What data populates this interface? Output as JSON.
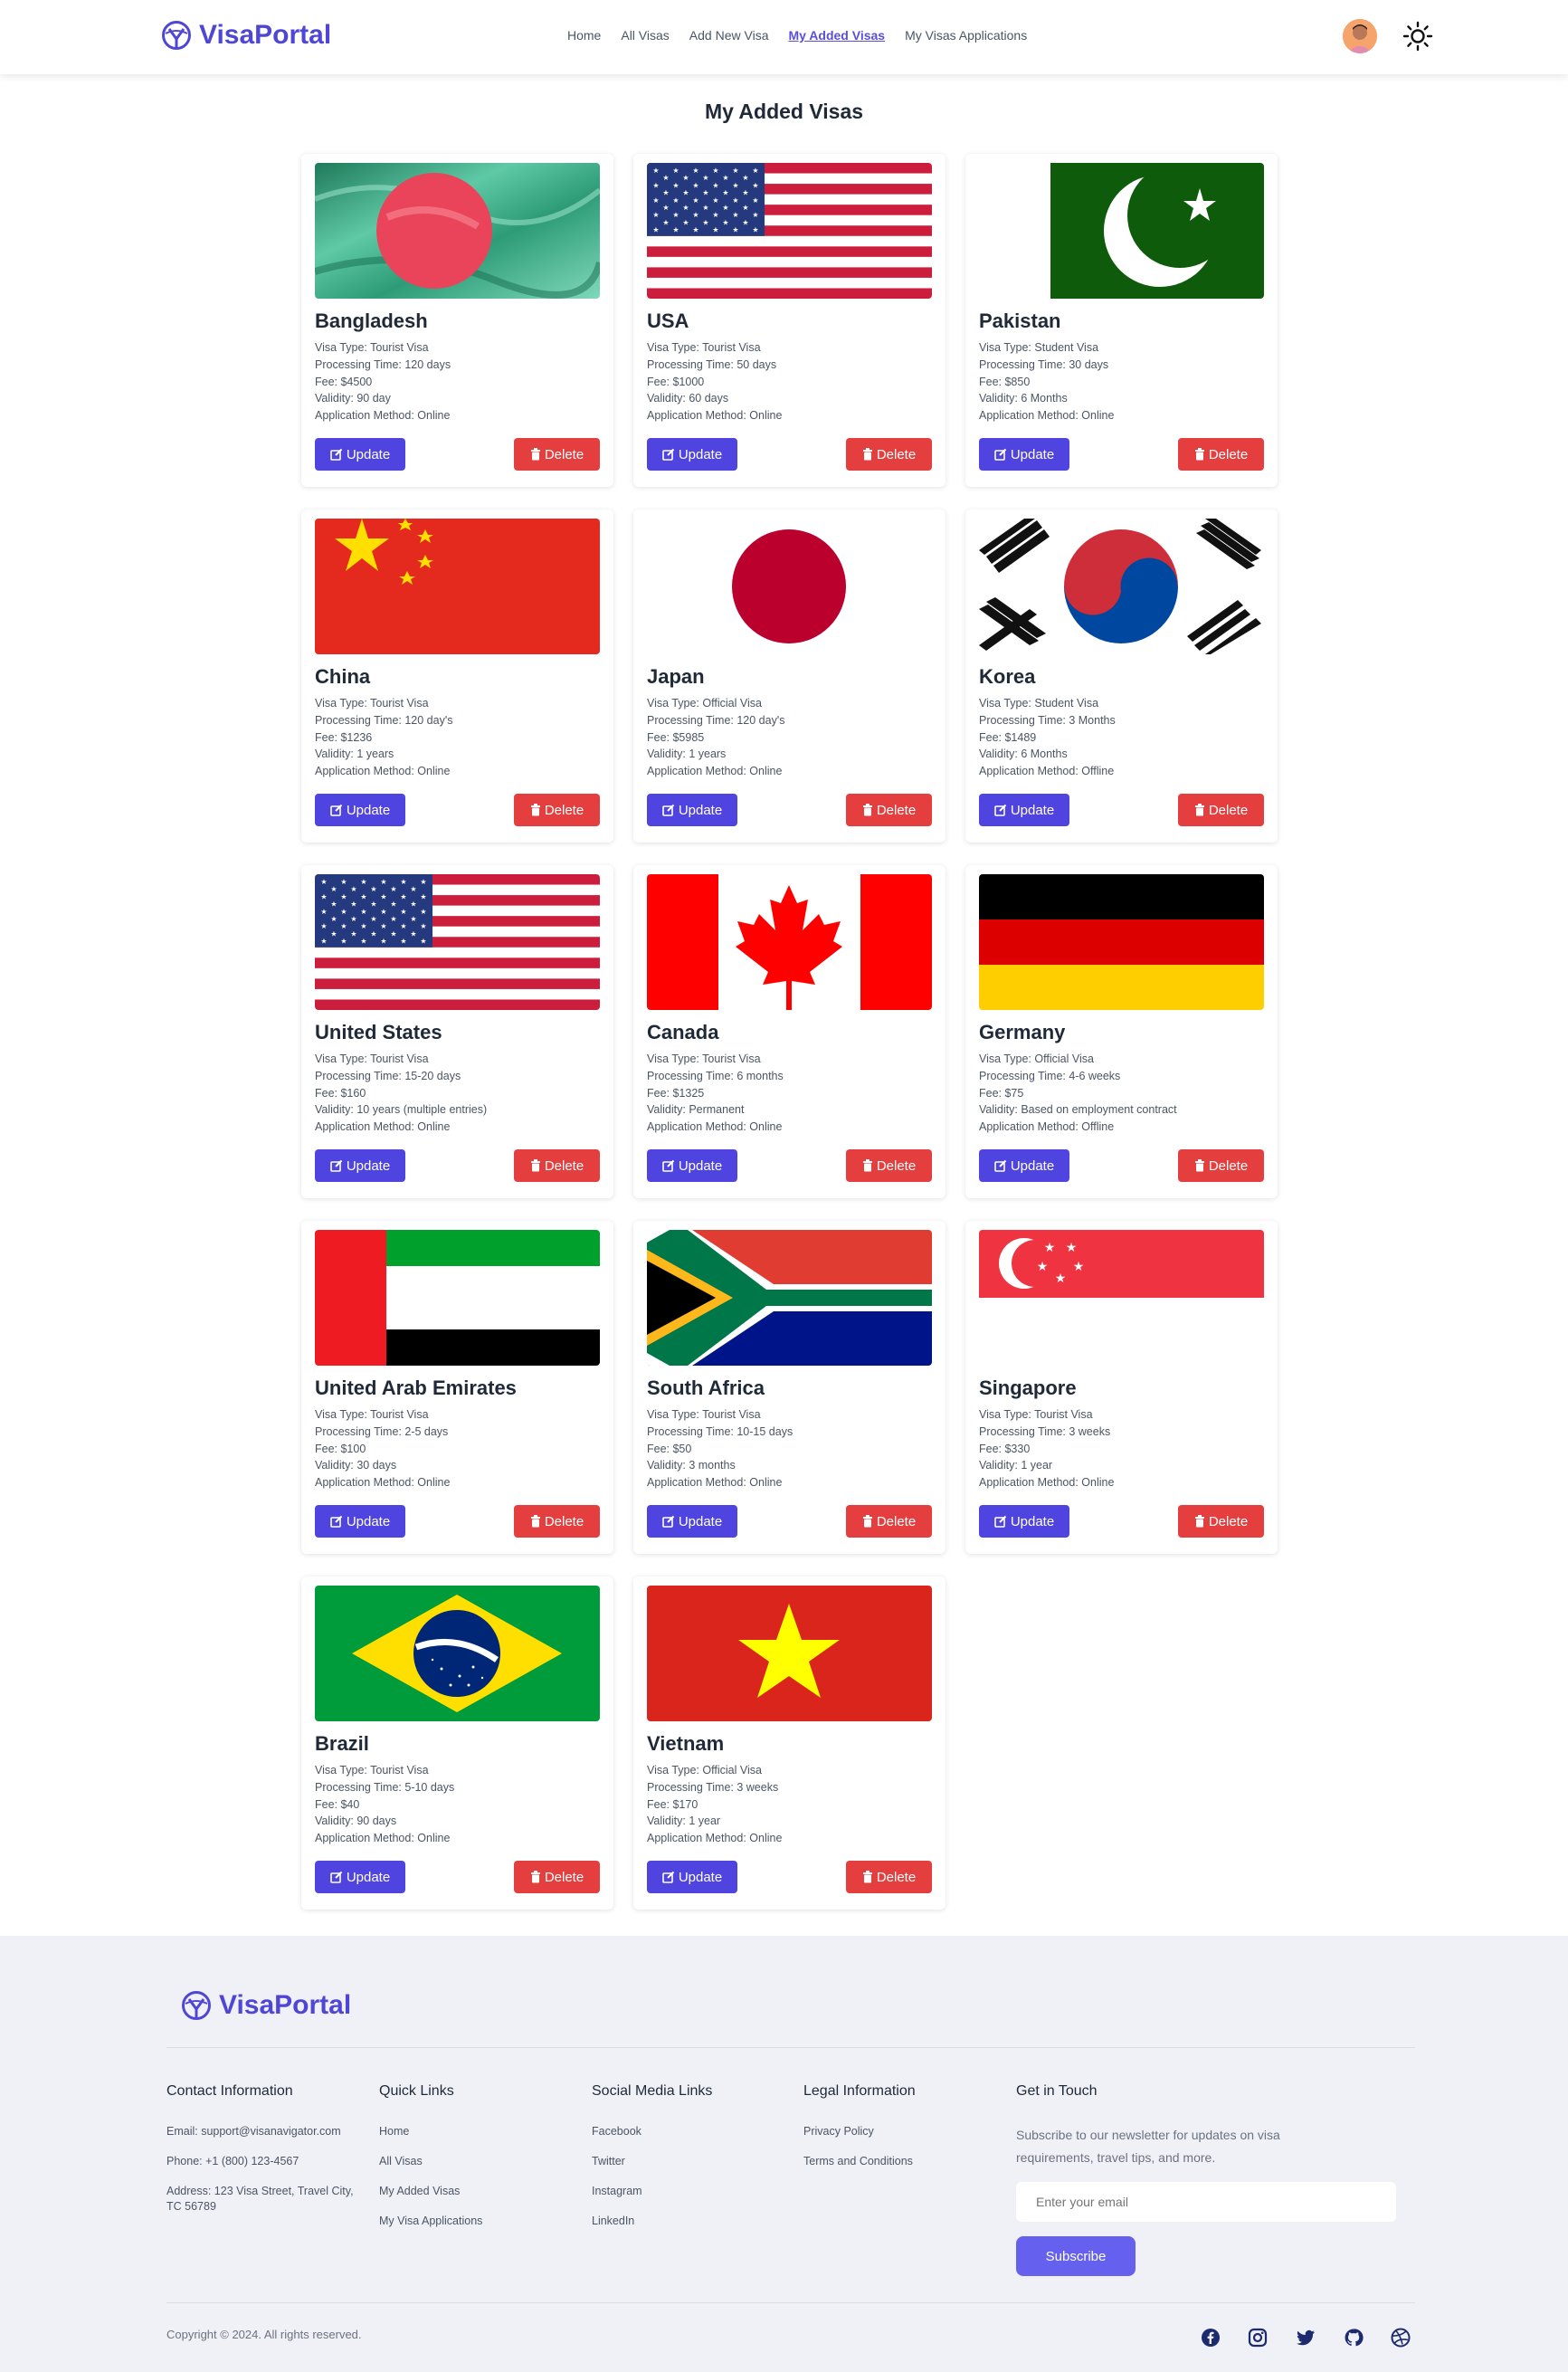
{
  "header": {
    "brand": "VisaPortal",
    "nav": [
      {
        "label": "Home"
      },
      {
        "label": "All Visas"
      },
      {
        "label": "Add New Visa"
      },
      {
        "label": "My Added Visas",
        "active": true
      },
      {
        "label": "My Visas Applications"
      }
    ]
  },
  "page_title": "My Added Visas",
  "button_labels": {
    "update": "Update",
    "delete": "Delete"
  },
  "cards": [
    {
      "country": "Bangladesh",
      "flag": "bangladesh",
      "lines": [
        "Visa Type: Tourist Visa",
        "Processing Time: 120 days",
        "Fee: $4500",
        "Validity: 90 day",
        "Application Method: Online"
      ]
    },
    {
      "country": "USA",
      "flag": "usa",
      "lines": [
        "Visa Type: Tourist Visa",
        "Processing Time: 50 days",
        "Fee: $1000",
        "Validity: 60 days",
        "Application Method: Online"
      ]
    },
    {
      "country": "Pakistan",
      "flag": "pakistan",
      "lines": [
        "Visa Type: Student Visa",
        "Processing Time: 30 days",
        "Fee: $850",
        "Validity: 6 Months",
        "Application Method: Online"
      ]
    },
    {
      "country": "China",
      "flag": "china",
      "lines": [
        "Visa Type: Tourist Visa",
        "Processing Time: 120 day's",
        "Fee: $1236",
        "Validity: 1 years",
        "Application Method: Online"
      ]
    },
    {
      "country": "Japan",
      "flag": "japan",
      "lines": [
        "Visa Type: Official Visa",
        "Processing Time: 120 day's",
        "Fee: $5985",
        "Validity: 1 years",
        "Application Method: Online"
      ]
    },
    {
      "country": "Korea",
      "flag": "korea",
      "lines": [
        "Visa Type: Student Visa",
        "Processing Time: 3 Months",
        "Fee: $1489",
        "Validity: 6 Months",
        "Application Method: Offline"
      ]
    },
    {
      "country": "United States",
      "flag": "usa",
      "lines": [
        "Visa Type: Tourist Visa",
        "Processing Time: 15-20 days",
        "Fee: $160",
        "Validity: 10 years (multiple entries)",
        "Application Method: Online"
      ]
    },
    {
      "country": "Canada",
      "flag": "canada",
      "lines": [
        "Visa Type: Tourist Visa",
        "Processing Time: 6 months",
        "Fee: $1325",
        "Validity: Permanent",
        "Application Method: Online"
      ]
    },
    {
      "country": "Germany",
      "flag": "germany",
      "lines": [
        "Visa Type: Official Visa",
        "Processing Time: 4-6 weeks",
        "Fee: $75",
        "Validity: Based on employment contract",
        "Application Method: Offline"
      ]
    },
    {
      "country": "United Arab Emirates",
      "flag": "uae",
      "lines": [
        "Visa Type: Tourist Visa",
        "Processing Time: 2-5 days",
        "Fee: $100",
        "Validity: 30 days",
        "Application Method: Online"
      ]
    },
    {
      "country": "South Africa",
      "flag": "southafrica",
      "lines": [
        "Visa Type: Tourist Visa",
        "Processing Time: 10-15 days",
        "Fee: $50",
        "Validity: 3 months",
        "Application Method: Online"
      ]
    },
    {
      "country": "Singapore",
      "flag": "singapore",
      "lines": [
        "Visa Type: Tourist Visa",
        "Processing Time: 3 weeks",
        "Fee: $330",
        "Validity: 1 year",
        "Application Method: Online"
      ]
    },
    {
      "country": "Brazil",
      "flag": "brazil",
      "lines": [
        "Visa Type: Tourist Visa",
        "Processing Time: 5-10 days",
        "Fee: $40",
        "Validity: 90 days",
        "Application Method: Online"
      ]
    },
    {
      "country": "Vietnam",
      "flag": "vietnam",
      "lines": [
        "Visa Type: Official Visa",
        "Processing Time: 3 weeks",
        "Fee: $170",
        "Validity: 1 year",
        "Application Method: Online"
      ]
    }
  ],
  "footer": {
    "brand": "VisaPortal",
    "contact": {
      "title": "Contact Information",
      "email": "Email: support@visanavigator.com",
      "phone": "Phone: +1 (800) 123-4567",
      "address": "Address: 123 Visa Street, Travel City, TC 56789"
    },
    "quick_links": {
      "title": "Quick Links",
      "items": [
        "Home",
        "All Visas",
        "My Added Visas",
        "My Visa Applications"
      ]
    },
    "social_links": {
      "title": "Social Media Links",
      "items": [
        "Facebook",
        "Twitter",
        "Instagram",
        "LinkedIn"
      ]
    },
    "legal": {
      "title": "Legal Information",
      "items": [
        "Privacy Policy",
        "Terms and Conditions"
      ]
    },
    "newsletter": {
      "title": "Get in Touch",
      "text": "Subscribe to our newsletter for updates on visa requirements, travel tips, and more.",
      "placeholder": "Enter your email",
      "button": "Subscribe"
    },
    "copyright": "Copyright © 2024. All rights reserved.",
    "social_icons": [
      "facebook-icon",
      "instagram-icon",
      "twitter-icon",
      "github-icon",
      "dribbble-icon"
    ]
  },
  "colors": {
    "brand": "#5046d6",
    "update": "#5044e0",
    "delete": "#e53e3e",
    "subscribe": "#6560ee",
    "footer_bg": "#eff1f6"
  }
}
